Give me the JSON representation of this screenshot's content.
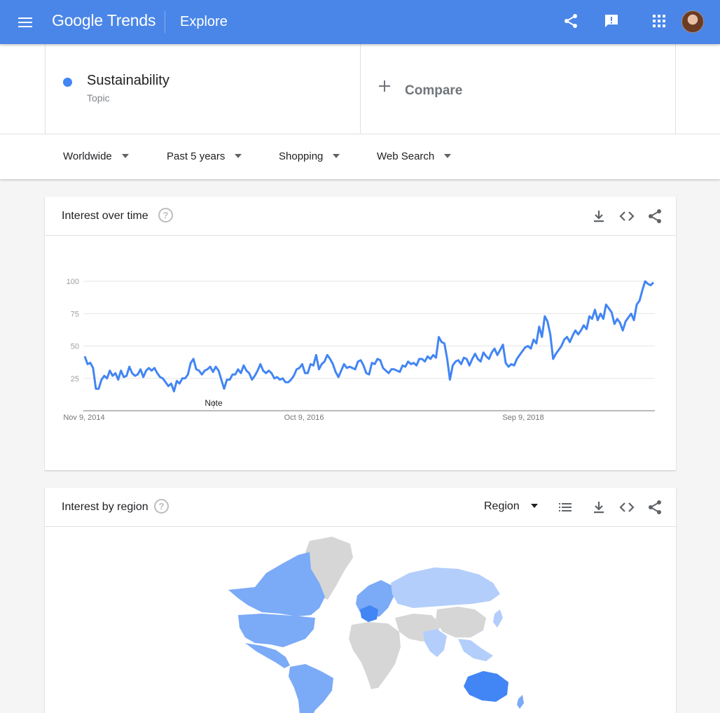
{
  "header": {
    "brand_google": "Google",
    "brand_trends": "Trends",
    "page": "Explore",
    "icons": [
      "menu-icon",
      "share-icon",
      "feedback-icon",
      "apps-icon",
      "account-avatar"
    ],
    "color": "#4a86e8"
  },
  "search": {
    "term": "Sustainability",
    "term_type": "Topic",
    "term_color": "#4285f4",
    "compare_label": "Compare"
  },
  "filters": {
    "location": "Worldwide",
    "time": "Past 5 years",
    "category": "Shopping",
    "property": "Web Search"
  },
  "interest_over_time": {
    "title": "Interest over time",
    "help": "?",
    "note_label": "Note",
    "icons": [
      "download-icon",
      "embed-icon",
      "share-icon"
    ]
  },
  "chart_data": {
    "type": "line",
    "title": "Interest over time",
    "xlabel": "",
    "ylabel": "",
    "ylim": [
      0,
      100
    ],
    "yticks": [
      25,
      50,
      75,
      100
    ],
    "xtick_labels": [
      "Nov 9, 2014",
      "Oct 9, 2016",
      "Sep 9, 2018"
    ],
    "grid": true,
    "series": [
      {
        "color": "#4285f4",
        "values": [
          42,
          36,
          37,
          33,
          17,
          17,
          24,
          27,
          25,
          31,
          27,
          29,
          24,
          31,
          26,
          27,
          34,
          29,
          27,
          28,
          32,
          26,
          31,
          33,
          31,
          33,
          29,
          26,
          25,
          22,
          19,
          21,
          15,
          23,
          21,
          25,
          25,
          28,
          37,
          40,
          32,
          31,
          28,
          31,
          32,
          34,
          30,
          34,
          31,
          24,
          17,
          24,
          24,
          28,
          28,
          32,
          29,
          35,
          31,
          29,
          24,
          27,
          31,
          36,
          31,
          29,
          31,
          29,
          25,
          26,
          24,
          25,
          22,
          22,
          24,
          27,
          32,
          33,
          36,
          29,
          29,
          36,
          35,
          43,
          32,
          36,
          38,
          43,
          40,
          36,
          30,
          26,
          31,
          36,
          33,
          34,
          33,
          32,
          38,
          39,
          35,
          29,
          28,
          37,
          36,
          40,
          39,
          33,
          31,
          29,
          32,
          32,
          31,
          30,
          35,
          34,
          38,
          36,
          37,
          35,
          40,
          40,
          38,
          42,
          40,
          43,
          41,
          57,
          53,
          52,
          40,
          24,
          35,
          38,
          39,
          36,
          41,
          40,
          35,
          40,
          44,
          40,
          38,
          45,
          42,
          40,
          45,
          48,
          43,
          47,
          51,
          37,
          34,
          36,
          35,
          40,
          43,
          46,
          49,
          50,
          48,
          55,
          52,
          65,
          57,
          73,
          69,
          59,
          40,
          44,
          47,
          50,
          55,
          57,
          53,
          58,
          62,
          59,
          62,
          66,
          63,
          73,
          71,
          78,
          70,
          75,
          71,
          82,
          79,
          76,
          67,
          71,
          68,
          62,
          69,
          72,
          75,
          70,
          82,
          85,
          93,
          100,
          98,
          97,
          99
        ]
      }
    ]
  },
  "interest_by_region": {
    "title": "Interest by region",
    "help": "?",
    "resolution": "Region",
    "icons": [
      "list-view-icon",
      "download-icon",
      "embed-icon",
      "share-icon"
    ],
    "map_colors": {
      "high": "#4285f4",
      "mid": "#7baaf7",
      "low": "#b3cefb",
      "none": "#d6d6d6"
    }
  }
}
